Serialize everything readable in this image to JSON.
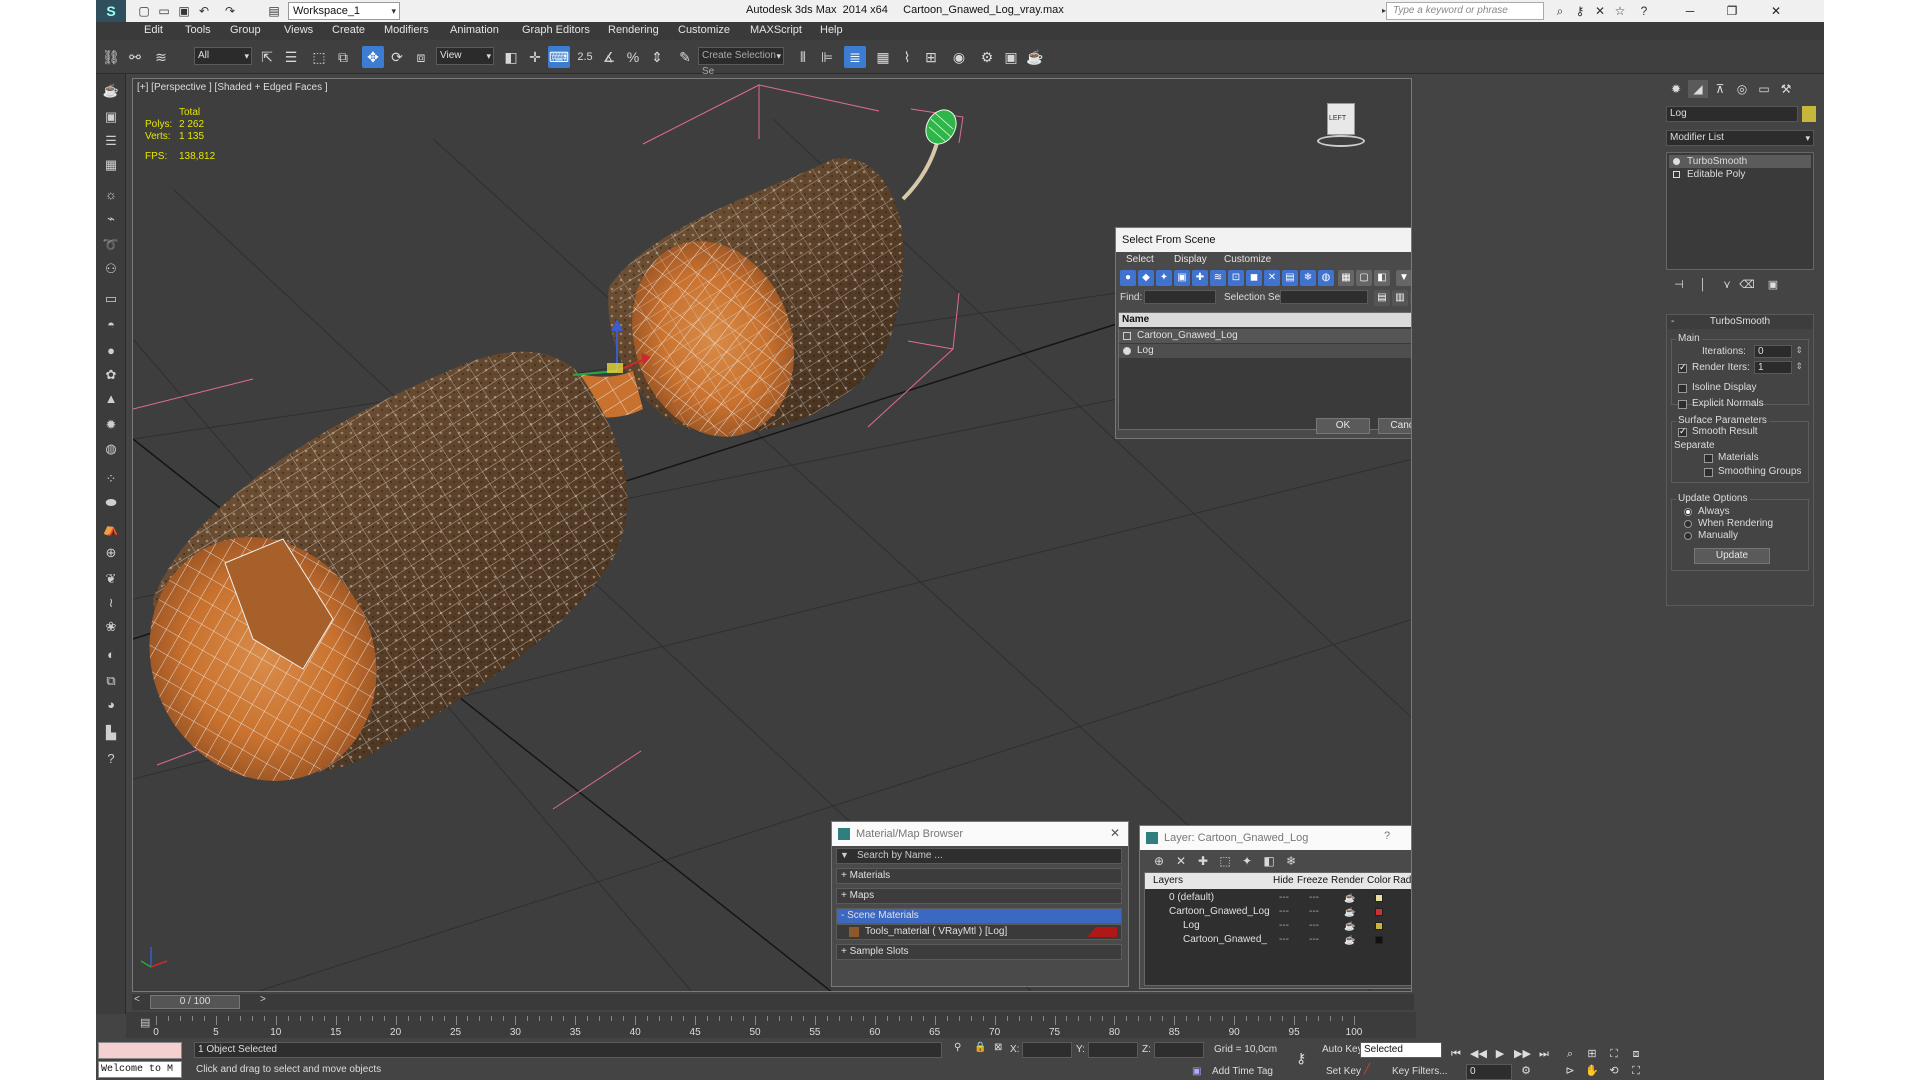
{
  "titlebar": {
    "workspace": "Workspace_1",
    "title": "Autodesk 3ds Max  2014 x64     Cartoon_Gnawed_Log_vray.max",
    "search_placeholder": "Type a keyword or phrase"
  },
  "menu": [
    "Edit",
    "Tools",
    "Group",
    "Views",
    "Create",
    "Modifiers",
    "Animation",
    "Graph Editors",
    "Rendering",
    "Customize",
    "MAXScript",
    "Help"
  ],
  "toolbar": {
    "filter_all": "All",
    "ref_coord": "View",
    "snap_label": "2.5",
    "selection_set": "Create Selection Se"
  },
  "viewport": {
    "label": "[+] [Perspective ] [Shaded + Edged Faces ]",
    "stats_header": "Total",
    "polys_label": "Polys:",
    "polys_value": "2 262",
    "verts_label": "Verts:",
    "verts_value": "1 135",
    "fps_label": "FPS:",
    "fps_value": "138,812",
    "viewcube_label": "LEFT"
  },
  "command_panel": {
    "object_name": "Log",
    "modifier_list": "Modifier List",
    "stack": [
      "TurboSmooth",
      "Editable Poly"
    ],
    "rollout_title": "TurboSmooth",
    "main_group": "Main",
    "iterations_label": "Iterations:",
    "iterations_value": "0",
    "render_iters_label": "Render Iters:",
    "render_iters_value": "1",
    "isoline": "Isoline Display",
    "explicit_normals": "Explicit Normals",
    "surface_params": "Surface Parameters",
    "smooth_result": "Smooth Result",
    "separate": "Separate",
    "materials": "Materials",
    "smoothing_groups": "Smoothing Groups",
    "update_options": "Update Options",
    "always": "Always",
    "when_rendering": "When Rendering",
    "manually": "Manually",
    "update_button": "Update"
  },
  "select_from_scene": {
    "title": "Select From Scene",
    "menu": [
      "Select",
      "Display",
      "Customize"
    ],
    "find_label": "Find:",
    "selection_set_label": "Selection Set:",
    "column_name": "Name",
    "rows": [
      "Cartoon_Gnawed_Log",
      "Log"
    ],
    "ok": "OK",
    "cancel": "Cancel"
  },
  "material_browser": {
    "title": "Material/Map Browser",
    "search": "Search by Name ...",
    "materials": "+ Materials",
    "maps": "+ Maps",
    "scene_materials": "- Scene Materials",
    "tools_material": "Tools_material  ( VRayMtl ) [Log]",
    "sample_slots": "+ Sample Slots"
  },
  "layer_dialog": {
    "title": "Layer: Cartoon_Gnawed_Log",
    "help": "?",
    "columns": [
      "Layers",
      "Hide",
      "Freeze",
      "Render",
      "Color",
      "Radiosity"
    ],
    "rows": [
      {
        "name": "0 (default)",
        "color": "#e8e0a0"
      },
      {
        "name": "Cartoon_Gnawed_Log",
        "color": "#c83232"
      },
      {
        "name": "Log",
        "color": "#c8b43c"
      },
      {
        "name": "Cartoon_Gnawed_",
        "color": "#111111"
      }
    ]
  },
  "timeline": {
    "frame_readout": "0 / 100",
    "ticks": [
      "0",
      "5",
      "10",
      "15",
      "20",
      "25",
      "30",
      "35",
      "40",
      "45",
      "50",
      "55",
      "60",
      "65",
      "70",
      "75",
      "80",
      "85",
      "90",
      "95",
      "100"
    ]
  },
  "status": {
    "maxscript_text": "Welcome to M",
    "selected": "1 Object Selected",
    "prompt": "Click and drag to select and move objects",
    "x_label": "X:",
    "y_label": "Y:",
    "z_label": "Z:",
    "grid": "Grid = 10,0cm",
    "add_time_tag": "Add Time Tag",
    "auto_key": "Auto Key",
    "set_key": "Set Key",
    "selected_dropdown": "Selected",
    "key_filters": "Key Filters...",
    "frame": "0"
  }
}
